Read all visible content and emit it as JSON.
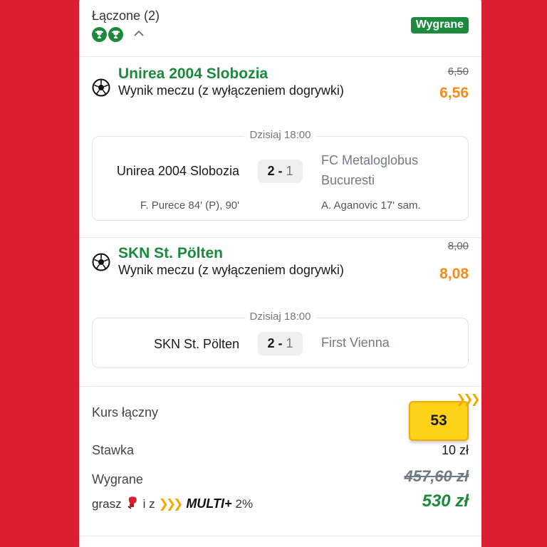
{
  "header": {
    "title": "Łączone (2)",
    "status_badge": "Wygrane"
  },
  "events": [
    {
      "team": "Unirea 2004 Slobozia",
      "market": "Wynik meczu (z wyłączeniem dogrywki)",
      "old_odd": "6,50",
      "new_odd": "6,56",
      "date": "Dzisiaj 18:00",
      "home": "Unirea 2004 Slobozia",
      "home_score": "2",
      "separator": "-",
      "away_score": "1",
      "away_line1": "FC Metaloglobus",
      "away_line2": "Bucuresti",
      "home_scorers": "F. Purece 84' (P), 90'",
      "away_scorers": "A. Aganovic 17' sam."
    },
    {
      "team": "SKN St. Pölten",
      "market": "Wynik meczu (z wyłączeniem dogrywki)",
      "old_odd": "8,00",
      "new_odd": "8,08",
      "date": "Dzisiaj 18:00",
      "home": "SKN St. Pölten",
      "home_score": "2",
      "separator": "-",
      "away_score": "1",
      "away": "First Vienna"
    }
  ],
  "summary": {
    "total_odds_label": "Kurs łączny",
    "total_odds": "53",
    "stake_label": "Stawka",
    "stake": "10 zł",
    "win_label": "Wygrane",
    "win_before": "457,60 zł",
    "win_final": "530 zł",
    "play_prefix": "grasz",
    "play_middle": "i z",
    "multi_logo": "MULTI+",
    "multi_percent": "2%"
  },
  "icons": [
    "trophy-icon",
    "chevron-up-icon",
    "soccer-ball-icon",
    "boxing-glove-icon",
    "multi-chevrons-icon"
  ],
  "colors": {
    "background": "#dc1f30",
    "brand_green": "#1b8a3d",
    "odd_orange": "#f28c1c",
    "odd_box_yellow": "#ffd21a"
  }
}
